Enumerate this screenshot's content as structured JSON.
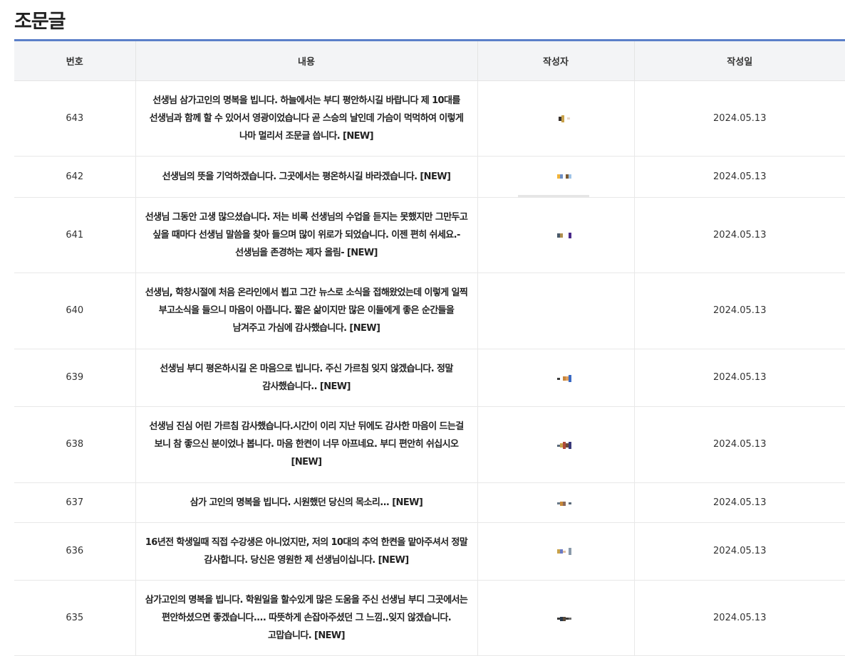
{
  "page": {
    "title": "조문글"
  },
  "table": {
    "headers": {
      "number": "번호",
      "content": "내용",
      "author": "작성자",
      "date": "작성일"
    },
    "rows": [
      {
        "number": "643",
        "content": "선생님 삼가고인의 명복을 빕니다. 하늘에서는 부디 평안하시길 바랍니다 제 10대를 선생님과 함께 할 수 있어서 영광이었습니다 곧 스승의 날인데 가슴이 먹먹하여 이렇게 나마 멀리서 조문글 씁니다. [NEW]",
        "date": "2024.05.13"
      },
      {
        "number": "642",
        "content": "선생님의 뜻을 기억하겠습니다. 그곳에서는 평온하시길 바라겠습니다. [NEW]",
        "date": "2024.05.13"
      },
      {
        "number": "641",
        "content": "선생님 그동안 고생 많으셨습니다. 저는 비록 선생님의 수업을 듣지는 못했지만 그만두고 싶을 때마다 선생님 말씀을 찾아 들으며 많이 위로가 되었습니다. 이젠 편히 쉬세요.-선생님을 존경하는 제자 올림- [NEW]",
        "date": "2024.05.13"
      },
      {
        "number": "640",
        "content": "선생님, 학창시절에 처음 온라인에서 뵙고 그간 뉴스로 소식을 접해왔었는데 이렇게 일찍 부고소식을 들으니 마음이 아픕니다. 짧은 삶이지만 많은 이들에게 좋은 순간들을 남겨주고 가심에 감사했습니다. [NEW]",
        "date": "2024.05.13"
      },
      {
        "number": "639",
        "content": "선생님 부디 평온하시길 온 마음으로 빕니다. 주신 가르침 잊지 않겠습니다. 정말 감사했습니다.. [NEW]",
        "date": "2024.05.13"
      },
      {
        "number": "638",
        "content": "선생님 진심 어린 가르침 감사했습니다.시간이 이리 지난 뒤에도 감사한 마음이 드는걸 보니 참 좋으신 분이었나 봅니다. 마음 한켠이 너무 아프네요. 부디 편안히 쉬십시오 [NEW]",
        "date": "2024.05.13"
      },
      {
        "number": "637",
        "content": "삼가 고인의 명복을 빕니다. 시원했던 당신의 목소리... [NEW]",
        "date": "2024.05.13"
      },
      {
        "number": "636",
        "content": "16년전 학생일때 직접 수강생은 아니었지만, 저의 10대의 추억 한켠을 맡아주셔서 정말 감사합니다. 당신은 영원한 제 선생님이십니다. [NEW]",
        "date": "2024.05.13"
      },
      {
        "number": "635",
        "content": "삼가고인의 명복을 빕니다. 학원일을 할수있게 많은 도움을 주신 선생님 부디 그곳에서는 편안하셨으면 좋겠습니다.... 따뜻하게 손잡아주셨던 그 느낌..잊지 않겠습니다. 고맙습니다. [NEW]",
        "date": "2024.05.13"
      }
    ]
  },
  "colors": {
    "accent_border": "#5b7fc9",
    "header_bg": "#f3f4f6"
  }
}
